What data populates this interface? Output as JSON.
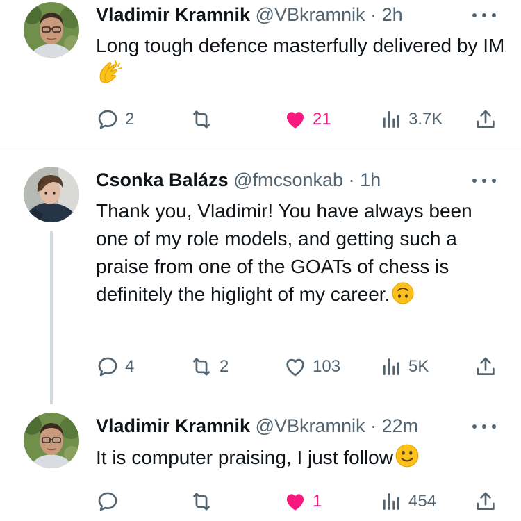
{
  "tweets": [
    {
      "author": "Vladimir Kramnik",
      "handle": "@VBkramnik",
      "separator": "·",
      "time": "2h",
      "text": "Long tough defence masterfully delivered by IM",
      "emoji": "clapping-hands",
      "replies": "2",
      "retweets": "",
      "likes": "21",
      "liked": true,
      "views": "3.7K"
    },
    {
      "author": "Csonka Balázs",
      "handle": "@fmcsonkab",
      "separator": "·",
      "time": "1h",
      "text": "Thank you, Vladimir! You have always been one of my role models, and getting such a praise from one of the GOATs of chess is definitely the higlight of my career.",
      "emoji": "upside-down-face",
      "replies": "4",
      "retweets": "2",
      "likes": "103",
      "liked": false,
      "views": "5K"
    },
    {
      "author": "Vladimir Kramnik",
      "handle": "@VBkramnik",
      "separator": "·",
      "time": "22m",
      "text": "It is computer praising, I just follow",
      "emoji": "slightly-smiling-face",
      "replies": "",
      "retweets": "",
      "likes": "1",
      "liked": true,
      "views": "454"
    }
  ],
  "colors": {
    "text": "#0f1419",
    "secondary": "#536471",
    "like_active": "#f91880",
    "divider": "#eff3f4",
    "thread_line": "#cfd9de"
  },
  "icons": [
    "reply-icon",
    "retweet-icon",
    "like-icon",
    "views-icon",
    "share-icon",
    "more-icon"
  ]
}
